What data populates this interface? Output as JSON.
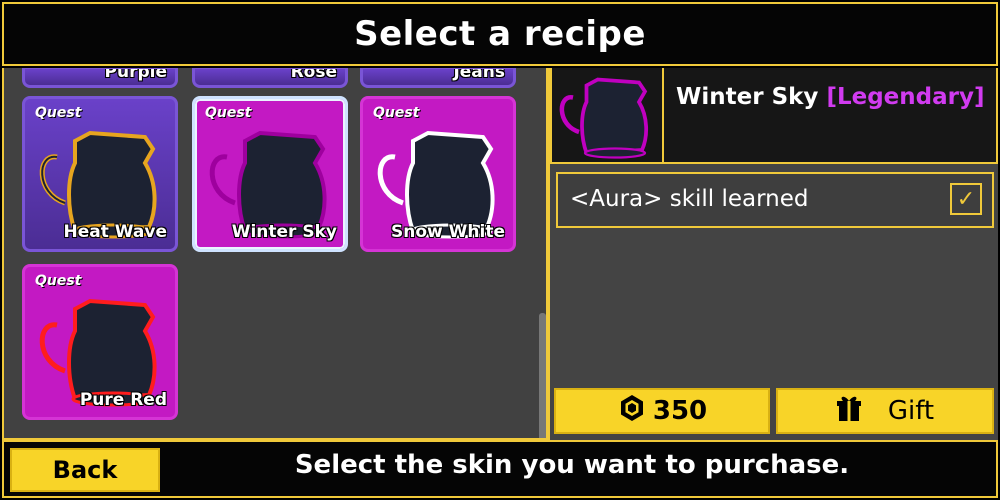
{
  "header": {
    "title": "Select a recipe"
  },
  "grid": {
    "partial_row": [
      {
        "name": "Purple"
      },
      {
        "name": "Rose"
      },
      {
        "name": "Jeans"
      }
    ],
    "cards": [
      {
        "tag": "Quest",
        "name": "Heat Wave",
        "theme": "purple",
        "outline": "#e7a51f"
      },
      {
        "tag": "Quest",
        "name": "Winter Sky",
        "theme": "pink",
        "outline": "#c000c0",
        "selected": true
      },
      {
        "tag": "Quest",
        "name": "Snow White",
        "theme": "pink",
        "outline": "#ffffff"
      },
      {
        "tag": "Quest",
        "name": "Pure Red",
        "theme": "pink",
        "outline": "#ff1d1d"
      }
    ]
  },
  "details": {
    "item_name": "Winter Sky",
    "rarity": "[Legendary]",
    "skill_text": "<Aura> skill learned",
    "checkbox_symbol": "✓",
    "price": "350",
    "gift_label": "Gift"
  },
  "footer": {
    "back_label": "Back",
    "message": "Select the skin you want to purchase."
  },
  "colors": {
    "accent_yellow": "#f0c93a",
    "button_yellow": "#f8d428",
    "legendary": "#d13bf0"
  }
}
